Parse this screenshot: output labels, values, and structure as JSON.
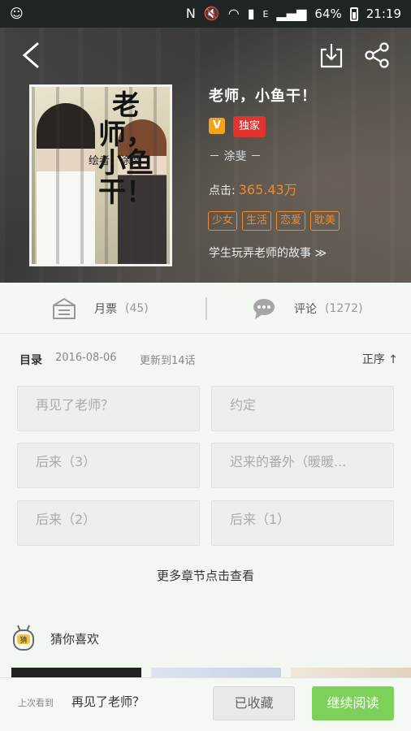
{
  "status_bar": {
    "battery": "64%",
    "time": "21:19",
    "network": "E"
  },
  "book": {
    "title": "老师，小鱼干！",
    "badge_v": "V",
    "exclusive": "独家",
    "author": "－ 涂斐 －",
    "clicks_label": "点击:",
    "clicks_value": "365.43万",
    "tags": [
      "少女",
      "生活",
      "恋爱",
      "耽美"
    ],
    "synopsis": "学生玩弄老师的故事 ≫",
    "cover": {
      "title": "老师，小鱼干！",
      "author": "绘者：涂斐"
    }
  },
  "actions": {
    "tickets_label": "月票",
    "tickets_count": "(45)",
    "comments_label": "评论",
    "comments_count": "(1272)"
  },
  "catalog": {
    "label": "目录",
    "date": "2016-08-06",
    "update": "更新到14话",
    "order": "正序 ↑",
    "chapters": [
      "再见了老师？",
      "约定",
      "后来（3）",
      "迟来的番外（暖暖...",
      "后来（2）",
      "后来（1）"
    ],
    "more": "更多章节点击查看"
  },
  "guess": {
    "title": "猜你喜欢",
    "icon_text": "猜"
  },
  "bottom": {
    "last_read_label": "上次看到",
    "last_read_chapter": "再见了老师？",
    "favorited": "已收藏",
    "continue": "继续阅读"
  },
  "colors": {
    "accent_orange": "#f08a2a",
    "exclusive_red": "#e0352f",
    "read_green": "#7dd05a"
  }
}
